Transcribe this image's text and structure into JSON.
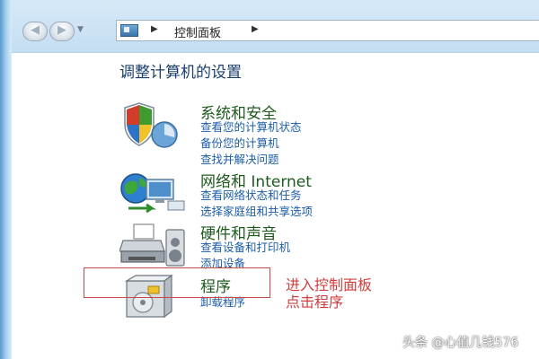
{
  "address": {
    "path_label": "控制面板"
  },
  "page_title": "调整计算机的设置",
  "categories": [
    {
      "title": "系统和安全",
      "links": [
        "查看您的计算机状态",
        "备份您的计算机",
        "查找并解决问题"
      ]
    },
    {
      "title": "网络和 Internet",
      "links": [
        "查看网络状态和任务",
        "选择家庭组和共享选项"
      ]
    },
    {
      "title": "硬件和声音",
      "links": [
        "查看设备和打印机",
        "添加设备"
      ]
    },
    {
      "title": "程序",
      "links": [
        "卸载程序"
      ]
    }
  ],
  "annotation": {
    "line1": "进入控制面板",
    "line2": "点击程序"
  },
  "watermark": "头条 @心值几钱576",
  "colors": {
    "category_title": "#1e5a1e",
    "link": "#1c5ea8",
    "annotation": "#d23c3c",
    "highlight_border": "#c94848"
  },
  "icons": {
    "system_security": "shield-icon",
    "network": "globe-network-icon",
    "hardware": "printer-icon",
    "programs": "programs-box-icon"
  }
}
